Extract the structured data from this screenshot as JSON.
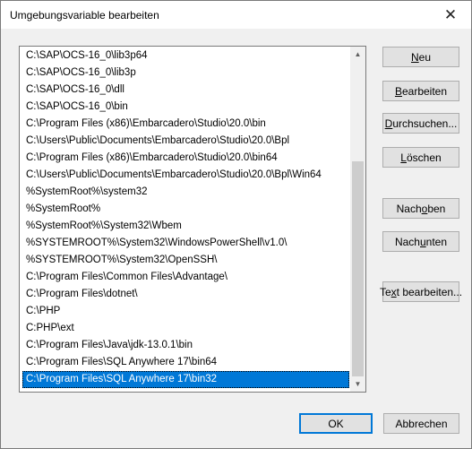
{
  "window": {
    "title": "Umgebungsvariable bearbeiten",
    "close_symbol": "✕"
  },
  "list": {
    "items": [
      "C:\\SAP\\OCS-16_0\\lib3p64",
      "C:\\SAP\\OCS-16_0\\lib3p",
      "C:\\SAP\\OCS-16_0\\dll",
      "C:\\SAP\\OCS-16_0\\bin",
      "C:\\Program Files (x86)\\Embarcadero\\Studio\\20.0\\bin",
      "C:\\Users\\Public\\Documents\\Embarcadero\\Studio\\20.0\\Bpl",
      "C:\\Program Files (x86)\\Embarcadero\\Studio\\20.0\\bin64",
      "C:\\Users\\Public\\Documents\\Embarcadero\\Studio\\20.0\\Bpl\\Win64",
      "%SystemRoot%\\system32",
      "%SystemRoot%",
      "%SystemRoot%\\System32\\Wbem",
      "%SYSTEMROOT%\\System32\\WindowsPowerShell\\v1.0\\",
      "%SYSTEMROOT%\\System32\\OpenSSH\\",
      "C:\\Program Files\\Common Files\\Advantage\\",
      "C:\\Program Files\\dotnet\\",
      "C:\\PHP",
      "C:PHP\\ext",
      "C:\\Program Files\\Java\\jdk-13.0.1\\bin",
      "C:\\Program Files\\SQL Anywhere 17\\bin64",
      "C:\\Program Files\\SQL Anywhere 17\\bin32"
    ],
    "selected_index": 19,
    "scroll_up_symbol": "▲",
    "scroll_down_symbol": "▼"
  },
  "buttons": {
    "new": {
      "pre": "",
      "mnemonic": "N",
      "post": "eu"
    },
    "edit": {
      "pre": "",
      "mnemonic": "B",
      "post": "earbeiten"
    },
    "browse": {
      "pre": "",
      "mnemonic": "D",
      "post": "urchsuchen..."
    },
    "delete": {
      "pre": "",
      "mnemonic": "L",
      "post": "öschen"
    },
    "move_up": {
      "pre": "Nach ",
      "mnemonic": "o",
      "post": "ben"
    },
    "move_down": {
      "pre": "Nach ",
      "mnemonic": "u",
      "post": "nten"
    },
    "edit_text": {
      "pre": "Te",
      "mnemonic": "x",
      "post": "t bearbeiten..."
    },
    "ok": "OK",
    "cancel": "Abbrechen"
  }
}
